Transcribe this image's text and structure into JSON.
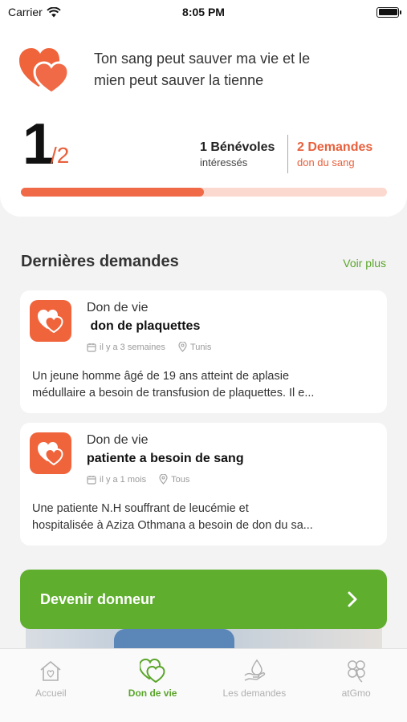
{
  "status_bar": {
    "carrier": "Carrier",
    "time": "8:05 PM"
  },
  "header": {
    "slogan_line1": "Ton sang peut sauver ma vie et le",
    "slogan_line2": "mien peut sauver la tienne",
    "count_current": "1",
    "count_total": "/2",
    "volunteers_title": "1 Bénévoles",
    "volunteers_sub": "intéressés",
    "requests_title": "2 Demandes",
    "requests_sub": "don du sang",
    "progress": 0.5
  },
  "section": {
    "title": "Dernières demandes",
    "see_more": "Voir plus"
  },
  "requests": [
    {
      "category": "Don de vie",
      "title": " don de plaquettes",
      "time": "il y a 3 semaines",
      "location": "Tunis",
      "desc_line1": "Un jeune homme âgé de 19 ans atteint de aplasie",
      "desc_line2": "médullaire a besoin de transfusion de plaquettes. Il e..."
    },
    {
      "category": "Don de vie",
      "title": "patiente a besoin de sang",
      "time": "il y a 1 mois",
      "location": "Tous",
      "desc_line1": "Une patiente N.H souffrant de leucémie et",
      "desc_line2": "hospitalisée à Aziza Othmana a besoin de don du sa..."
    }
  ],
  "cta": {
    "label": "Devenir donneur",
    "icon": "chevron-right-icon"
  },
  "tabs": [
    {
      "label": "Accueil",
      "icon": "home-icon"
    },
    {
      "label": "Don de vie",
      "icon": "hearts-icon"
    },
    {
      "label": "Les demandes",
      "icon": "blood-drop-hand-icon"
    },
    {
      "label": "atGmo",
      "icon": "clover-icon"
    }
  ],
  "colors": {
    "accent": "#f06a47",
    "green": "#5fae2e",
    "progress_track": "#fcd9cf"
  }
}
